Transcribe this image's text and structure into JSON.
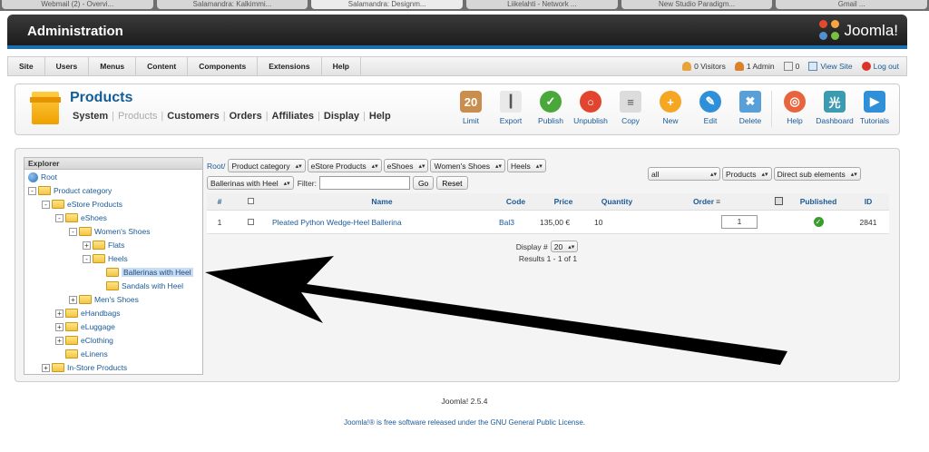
{
  "browser_tabs": [
    "Webmail (2) - Overvi...",
    "Salamandra: Kalkimmi...",
    "Salamandra: Designm...",
    "Liikelahti - Network ...",
    "New Studio Paradigm...",
    "Gmail ..."
  ],
  "header": {
    "title": "Administration",
    "logo_text": "Joomla!"
  },
  "menubar": {
    "items": [
      "Site",
      "Users",
      "Menus",
      "Content",
      "Components",
      "Extensions",
      "Help"
    ],
    "status": {
      "visitors": "0 Visitors",
      "admin": "1 Admin",
      "messages": "0",
      "view_site": "View Site",
      "logout": "Log out"
    }
  },
  "page": {
    "title": "Products",
    "submenu": [
      "System",
      "Products",
      "Customers",
      "Orders",
      "Affiliates",
      "Display",
      "Help"
    ],
    "active_submenu": "Products"
  },
  "toolbar": {
    "buttons": [
      {
        "label": "Limit",
        "icon": "limit-icon"
      },
      {
        "label": "Export",
        "icon": "export-icon"
      },
      {
        "label": "Publish",
        "icon": "publish-icon"
      },
      {
        "label": "Unpublish",
        "icon": "unpublish-icon"
      },
      {
        "label": "Copy",
        "icon": "copy-icon"
      },
      {
        "label": "New",
        "icon": "new-icon"
      },
      {
        "label": "Edit",
        "icon": "edit-icon"
      },
      {
        "label": "Delete",
        "icon": "delete-icon"
      },
      {
        "label": "Help",
        "icon": "help-icon"
      },
      {
        "label": "Dashboard",
        "icon": "dashboard-icon"
      },
      {
        "label": "Tutorials",
        "icon": "tutorials-icon"
      }
    ]
  },
  "explorer": {
    "title": "Explorer",
    "tree": [
      {
        "label": "Root",
        "depth": 0,
        "toggle": "",
        "kind": "globe"
      },
      {
        "label": "Product category",
        "depth": 0,
        "toggle": "-",
        "kind": "folder"
      },
      {
        "label": "eStore Products",
        "depth": 1,
        "toggle": "-",
        "kind": "folder"
      },
      {
        "label": "eShoes",
        "depth": 2,
        "toggle": "-",
        "kind": "folder"
      },
      {
        "label": "Women's Shoes",
        "depth": 3,
        "toggle": "-",
        "kind": "folder"
      },
      {
        "label": "Flats",
        "depth": 4,
        "toggle": "+",
        "kind": "folder"
      },
      {
        "label": "Heels",
        "depth": 4,
        "toggle": "-",
        "kind": "folder"
      },
      {
        "label": "Ballerinas with Heel",
        "depth": 5,
        "toggle": "",
        "kind": "folder",
        "selected": true
      },
      {
        "label": "Sandals with Heel",
        "depth": 5,
        "toggle": "",
        "kind": "folder"
      },
      {
        "label": "Men's Shoes",
        "depth": 3,
        "toggle": "+",
        "kind": "folder"
      },
      {
        "label": "eHandbags",
        "depth": 2,
        "toggle": "+",
        "kind": "folder"
      },
      {
        "label": "eLuggage",
        "depth": 2,
        "toggle": "+",
        "kind": "folder"
      },
      {
        "label": "eClothing",
        "depth": 2,
        "toggle": "+",
        "kind": "folder"
      },
      {
        "label": "eLinens",
        "depth": 2,
        "toggle": "",
        "kind": "folder"
      },
      {
        "label": "In-Store Products",
        "depth": 1,
        "toggle": "+",
        "kind": "folder"
      }
    ]
  },
  "breadcrumb": {
    "root": "Root/",
    "selects": [
      "Product category",
      "eStore Products",
      "eShoes",
      "Women's Shoes",
      "Heels"
    ],
    "second_row_select": "Ballerinas with Heel"
  },
  "filter": {
    "label": "Filter:",
    "value": "",
    "go": "Go",
    "reset": "Reset"
  },
  "right_filters": [
    "all",
    "Products",
    "Direct sub elements"
  ],
  "grid": {
    "columns": [
      "#",
      "",
      "Name",
      "Code",
      "Price",
      "Quantity",
      "Order",
      "",
      "Published",
      "ID"
    ],
    "rows": [
      {
        "num": "1",
        "name": "Pleated Python Wedge-Heel Ballerina",
        "code": "Bal3",
        "price": "135,00 €",
        "quantity": "10",
        "order": "1",
        "published": true,
        "id": "2841"
      }
    ]
  },
  "pager": {
    "display_label": "Display #",
    "display_value": "20",
    "results": "Results 1 - 1 of 1"
  },
  "footer": {
    "version": "Joomla! 2.5.4",
    "license_prefix": "Joomla!® is free software released under the",
    "license_link": "GNU General Public License",
    "license_suffix": "."
  }
}
